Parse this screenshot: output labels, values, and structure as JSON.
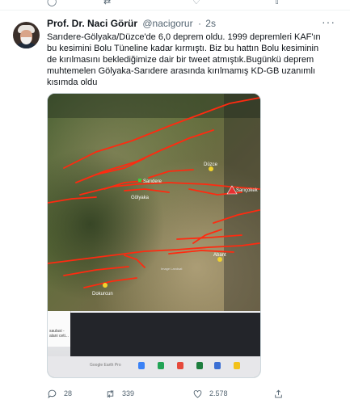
{
  "tweet": {
    "author_name": "Prof. Dr. Naci Görür",
    "handle": "@nacigorur",
    "separator": "·",
    "time": "2s",
    "text": "Sarıdere-Gölyaka/Düzce'de 6,0 deprem oldu. 1999 depremleri KAF'ın bu kesimini Bolu Tüneline kadar kırmıştı. Biz bu hattın Bolu kesiminin de kırılmasını beklediğimize dair bir tweet atmıştık.Bugünkü deprem muhtemelen Gölyaka-Sarıdere arasında kırılmamış KD-GB uzanımlı kısımda oldu",
    "more_label": "···"
  },
  "map": {
    "labels": {
      "saridere": "Sarıdere",
      "golyaka": "Gölyaka",
      "duzce": "Düzce",
      "sarcokek": "Sarıçokek",
      "abant": "Abant",
      "dokurcun": "Dokurcun",
      "watermark": "Image Landsat"
    },
    "fault_color": "#ff2a10"
  },
  "laptop": {
    "window_text": "saulasi -\nalani ceti...",
    "taskbar_label": "Google Earth Pro"
  },
  "actions": {
    "reply_count": "28",
    "retweet_count": "339",
    "like_count": "2.578"
  }
}
